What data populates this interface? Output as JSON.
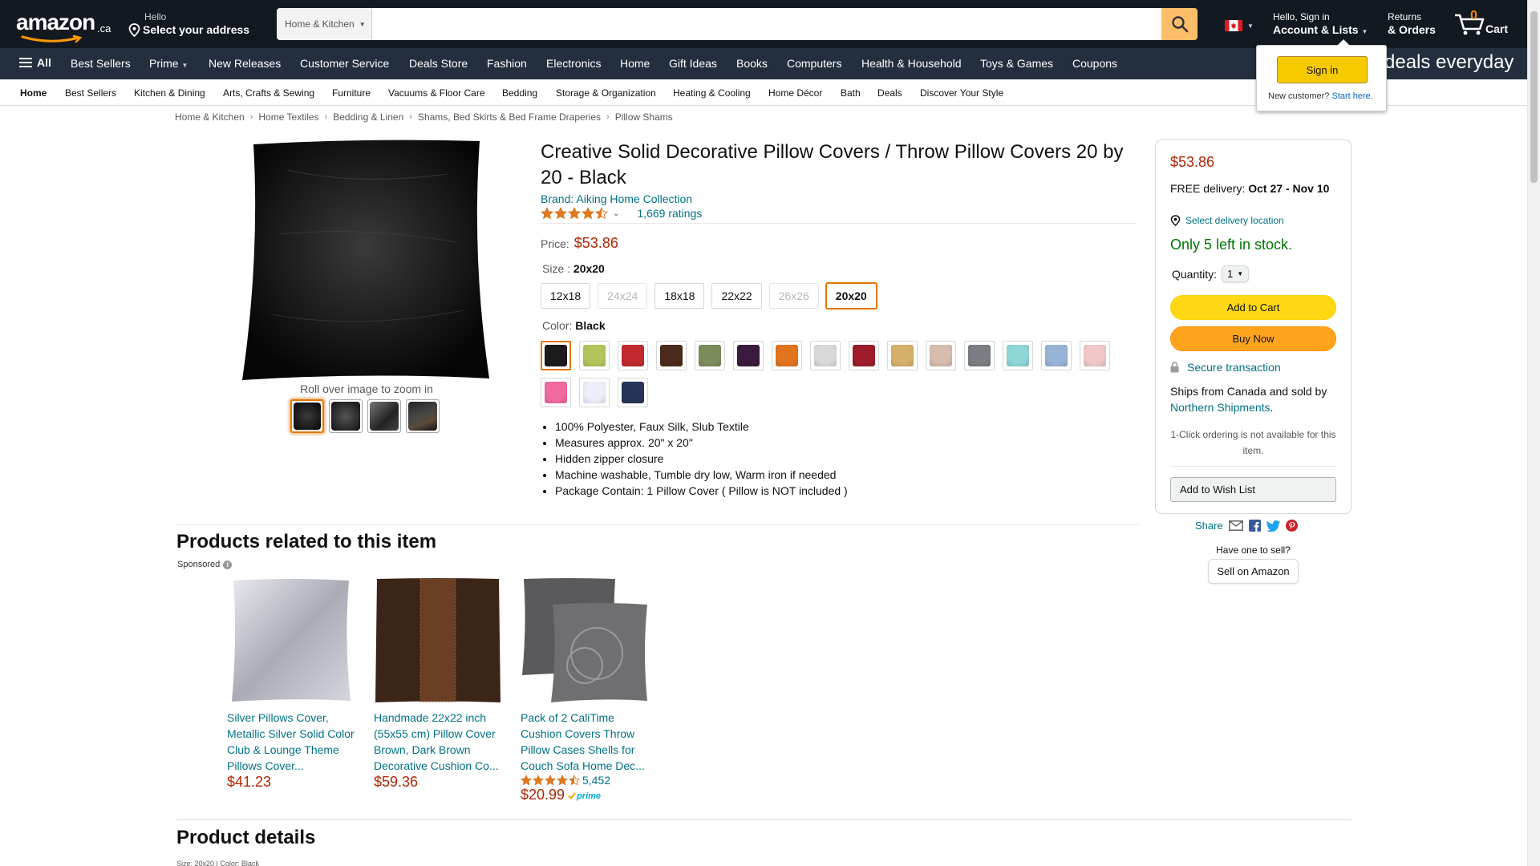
{
  "nav": {
    "logo_word": "amazon",
    "logo_tld": ".ca",
    "deliver_line1": "Hello",
    "deliver_line2": "Select your address",
    "search_dept": "Home & Kitchen",
    "search_placeholder": "",
    "account_line1": "Hello, Sign in",
    "account_line2": "Account & Lists",
    "orders_line1": "Returns",
    "orders_line2": "& Orders",
    "cart_count": "0",
    "cart_label": "Cart"
  },
  "main_nav": {
    "all_label": "All",
    "items": [
      "Best Sellers",
      "Prime",
      "New Releases",
      "Customer Service",
      "Deals Store",
      "Fashion",
      "Electronics",
      "Home",
      "Gift Ideas",
      "Books",
      "Computers",
      "Health & Household",
      "Toys & Games",
      "Coupons"
    ],
    "promo": "deals everyday"
  },
  "sub_nav": {
    "items": [
      "Home",
      "Best Sellers",
      "Kitchen & Dining",
      "Arts, Crafts & Sewing",
      "Furniture",
      "Vacuums & Floor Care",
      "Bedding",
      "Storage & Organization",
      "Heating & Cooling",
      "Home Décor",
      "Bath",
      "Deals",
      "Discover Your Style"
    ]
  },
  "signin_flyout": {
    "button": "Sign in",
    "new_customer": "New customer?",
    "start_here": "Start here."
  },
  "breadcrumb": [
    "Home & Kitchen",
    "Home Textiles",
    "Bedding & Linen",
    "Shams, Bed Skirts & Bed Frame Draperies",
    "Pillow Shams"
  ],
  "gallery": {
    "zoom_hint": "Roll over image to zoom in",
    "thumb_count": 4,
    "selected_thumb": 0
  },
  "product": {
    "title": "Creative Solid Decorative Pillow Covers / Throw Pillow Covers 20 by 20 - Black",
    "brand": "Brand: Aiking Home Collection",
    "rating": 4.5,
    "ratings_count": "1,669 ratings",
    "price_label": "Price:",
    "price": "$53.86",
    "size_label": "Size :",
    "size_value": "20x20",
    "sizes": [
      {
        "label": "12x18",
        "state": "available"
      },
      {
        "label": "24x24",
        "state": "unavailable"
      },
      {
        "label": "18x18",
        "state": "available"
      },
      {
        "label": "22x22",
        "state": "available"
      },
      {
        "label": "26x26",
        "state": "unavailable"
      },
      {
        "label": "20x20",
        "state": "selected"
      }
    ],
    "color_label": "Color:",
    "color_value": "Black",
    "swatches": [
      "#1b1b1b",
      "#b5c45a",
      "#c12a2e",
      "#4a2b1c",
      "#7d8c5c",
      "#3b1b3d",
      "#e3741e",
      "#d9d9d9",
      "#9e1b2c",
      "#d6b06a",
      "#d8bcae",
      "#7a7d82",
      "#8fd6d6",
      "#98b4d6",
      "#f0c8c8",
      "#f06aa0",
      "#eceefa",
      "#273458"
    ],
    "selected_swatch": 0,
    "bullets": [
      "100% Polyester, Faux Silk, Slub Textile",
      "Measures approx. 20\" x 20\"",
      "Hidden zipper closure",
      "Machine washable, Tumble dry low, Warm iron if needed",
      "Package Contain: 1 Pillow Cover ( Pillow is NOT included )"
    ]
  },
  "buybox": {
    "price": "$53.86",
    "delivery_prefix": "FREE delivery:",
    "delivery_dates": "Oct 27 - Nov 10",
    "location": "Select delivery location",
    "stock": "Only 5 left in stock.",
    "qty_label": "Quantity:",
    "qty_value": "1",
    "add_to_cart": "Add to Cart",
    "buy_now": "Buy Now",
    "secure": "Secure transaction",
    "ships_prefix": "Ships from Canada and sold by",
    "seller": "Northern Shipments",
    "ships_suffix": ".",
    "oneclick": "1-Click ordering is not available for this item.",
    "wishlist": "Add to Wish List"
  },
  "share": {
    "label": "Share",
    "have_one": "Have one to sell?",
    "sell": "Sell on Amazon"
  },
  "related": {
    "title": "Products related to this item",
    "sponsored": "Sponsored",
    "products": [
      {
        "name": "Silver Pillows Cover, Metallic Silver Solid Color Club & Lounge Theme Pillows Cover...",
        "price": "$41.23",
        "reviews": "",
        "prime": false
      },
      {
        "name": "Handmade 22x22 inch (55x55 cm) Pillow Cover Brown, Dark Brown Decorative Cushion Co...",
        "price": "$59.36",
        "reviews": "",
        "prime": false
      },
      {
        "name": "Pack of 2 CaliTime Cushion Covers Throw Pillow Cases Shells for Couch Sofa Home Dec...",
        "price": "$20.99",
        "reviews": "5,452",
        "prime": true,
        "prime_label": "prime"
      }
    ]
  },
  "details": {
    "title": "Product details",
    "sub": "Size: 20x20 | Color: Black"
  }
}
